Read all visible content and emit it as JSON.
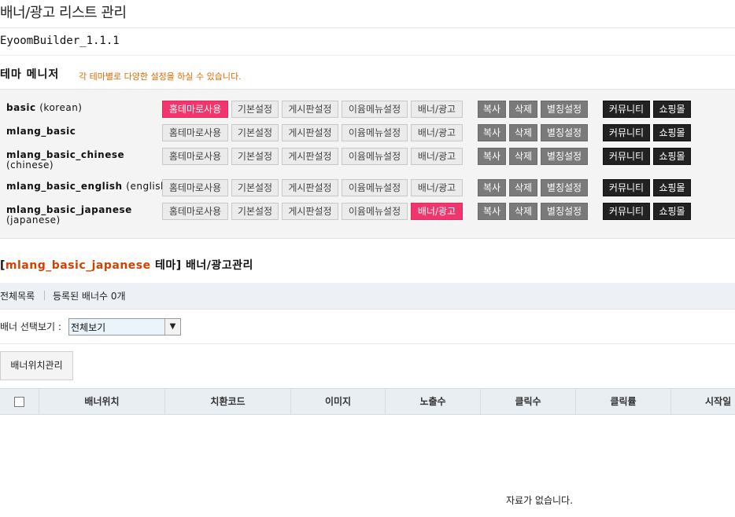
{
  "page": {
    "title": "배너/광고 리스트 관리"
  },
  "version": "EyoomBuilder_1.1.1",
  "theme_section": {
    "title": "테마 메니저",
    "subtitle": "각 테마별로 다양한 설정을 하실 수 있습니다."
  },
  "theme_buttons": {
    "home": "홈테마로사용",
    "basic_settings": "기본설정",
    "board_settings": "게시판설정",
    "menu_settings": "이윰메뉴설정",
    "banner": "배너/광고",
    "copy": "복사",
    "delete": "삭제",
    "alias": "별칭설정",
    "community": "커뮤니티",
    "shop": "쇼핑몰"
  },
  "themes": [
    {
      "name": "basic",
      "sub": "(korean)",
      "sub_inline": true,
      "home_active": true,
      "banner_active": false
    },
    {
      "name": "mlang_basic",
      "sub": "",
      "sub_inline": true,
      "home_active": false,
      "banner_active": false
    },
    {
      "name": "mlang_basic_chinese",
      "sub": "(chinese)",
      "sub_inline": false,
      "home_active": false,
      "banner_active": false
    },
    {
      "name": "mlang_basic_english",
      "sub": "(english)",
      "sub_inline": true,
      "home_active": false,
      "banner_active": false
    },
    {
      "name": "mlang_basic_japanese",
      "sub": "(japanese)",
      "sub_inline": false,
      "home_active": false,
      "banner_active": true
    }
  ],
  "banner_section": {
    "open_bracket": "[",
    "theme": "mlang_basic_japanese",
    "suffix": " 테마] 배너/광고관리"
  },
  "info_bar": {
    "all_list": "전체목록",
    "count_text": "등록된 배너수 0개"
  },
  "filter": {
    "label": "배너 선택보기 :",
    "selected": "전체보기"
  },
  "position_button": "배너위치관리",
  "table": {
    "columns": [
      "배너위치",
      "치환코드",
      "이미지",
      "노출수",
      "클릭수",
      "클릭률",
      "시작일"
    ],
    "empty_message": "자료가 없습니다."
  },
  "colors": {
    "active_pink": "#f0366c",
    "highlight_orange": "#d54000",
    "subtitle_orange": "#d96a00",
    "dark_button": "#222222",
    "gray_button": "#7a7a7a"
  }
}
